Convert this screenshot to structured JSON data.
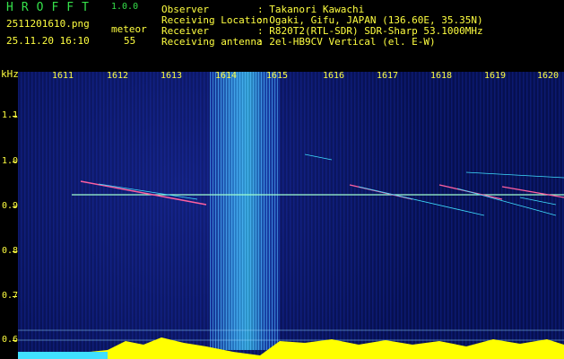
{
  "header": {
    "app_name": "HROFFT",
    "version": "1.0.0",
    "filename": "2511201610.png",
    "datetime": "25.11.20 16:10",
    "category_label": "meteor",
    "count": "55",
    "info": [
      {
        "key": "Observer",
        "value": ": Takanori Kawachi"
      },
      {
        "key": "Receiving Location",
        "value": ": Ogaki, Gifu, JAPAN (136.60E, 35.35N)"
      },
      {
        "key": "Receiver",
        "value": ": R820T2(RTL-SDR) SDR-Sharp 53.1000MHz"
      },
      {
        "key": "Receiving antenna",
        "value": ": 2el-HB9CV Vertical (el. E-W)"
      }
    ]
  },
  "spectrogram": {
    "y_unit": "kHz",
    "y_ticks": [
      "1.1",
      "1.0",
      "0.9",
      "0.8",
      "0.7",
      "0.6"
    ],
    "x_ticks": [
      "1611",
      "1612",
      "1613",
      "1614",
      "1615",
      "1616",
      "1617",
      "1618",
      "1619",
      "1620"
    ],
    "colors": {
      "text": "#ffff40",
      "title": "#35e04a",
      "background": "#081458",
      "baseline": "#ffff00",
      "carrier": "#a0ffd0",
      "meteor": "#ff60a0"
    }
  }
}
